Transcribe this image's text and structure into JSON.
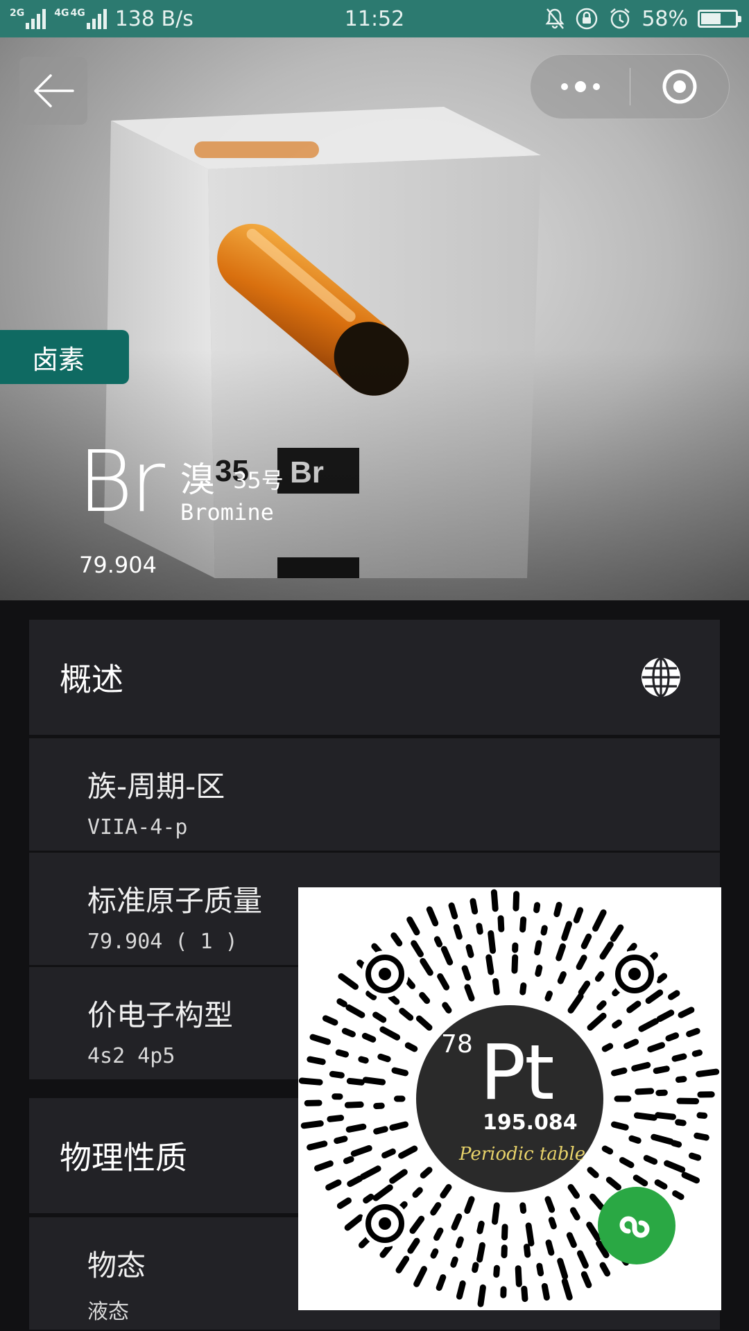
{
  "status_bar": {
    "net_1": "2G",
    "net_2": "4G",
    "net_3": "4G",
    "speed": "138 B/s",
    "time": "11:52",
    "battery": "58%",
    "battery_level": 0.58
  },
  "hero": {
    "category": "卤素",
    "symbol": "Br",
    "name_cn": "溴",
    "number_label": "35号",
    "name_en": "Bromine",
    "atomic_mass": "79.904",
    "cube_number": "35",
    "cube_symbol": "Br"
  },
  "sections": {
    "overview": {
      "title": "概述",
      "rows": [
        {
          "label": "族-周期-区",
          "value": "VIIA-4-p"
        },
        {
          "label": "标准原子质量",
          "value": "79.904 ( 1 )"
        },
        {
          "label": "价电子构型",
          "value": "4s2 4p5"
        }
      ]
    },
    "physical": {
      "title": "物理性质",
      "rows": [
        {
          "label": "物态",
          "value": "液态"
        }
      ]
    }
  },
  "qr": {
    "number": "78",
    "symbol": "Pt",
    "mass": "195.084",
    "caption": "Periodic table"
  },
  "colors": {
    "status_bar": "#2c7a70",
    "badge": "#0f6a62",
    "card": "#222226",
    "mini_program": "#2aa844"
  }
}
